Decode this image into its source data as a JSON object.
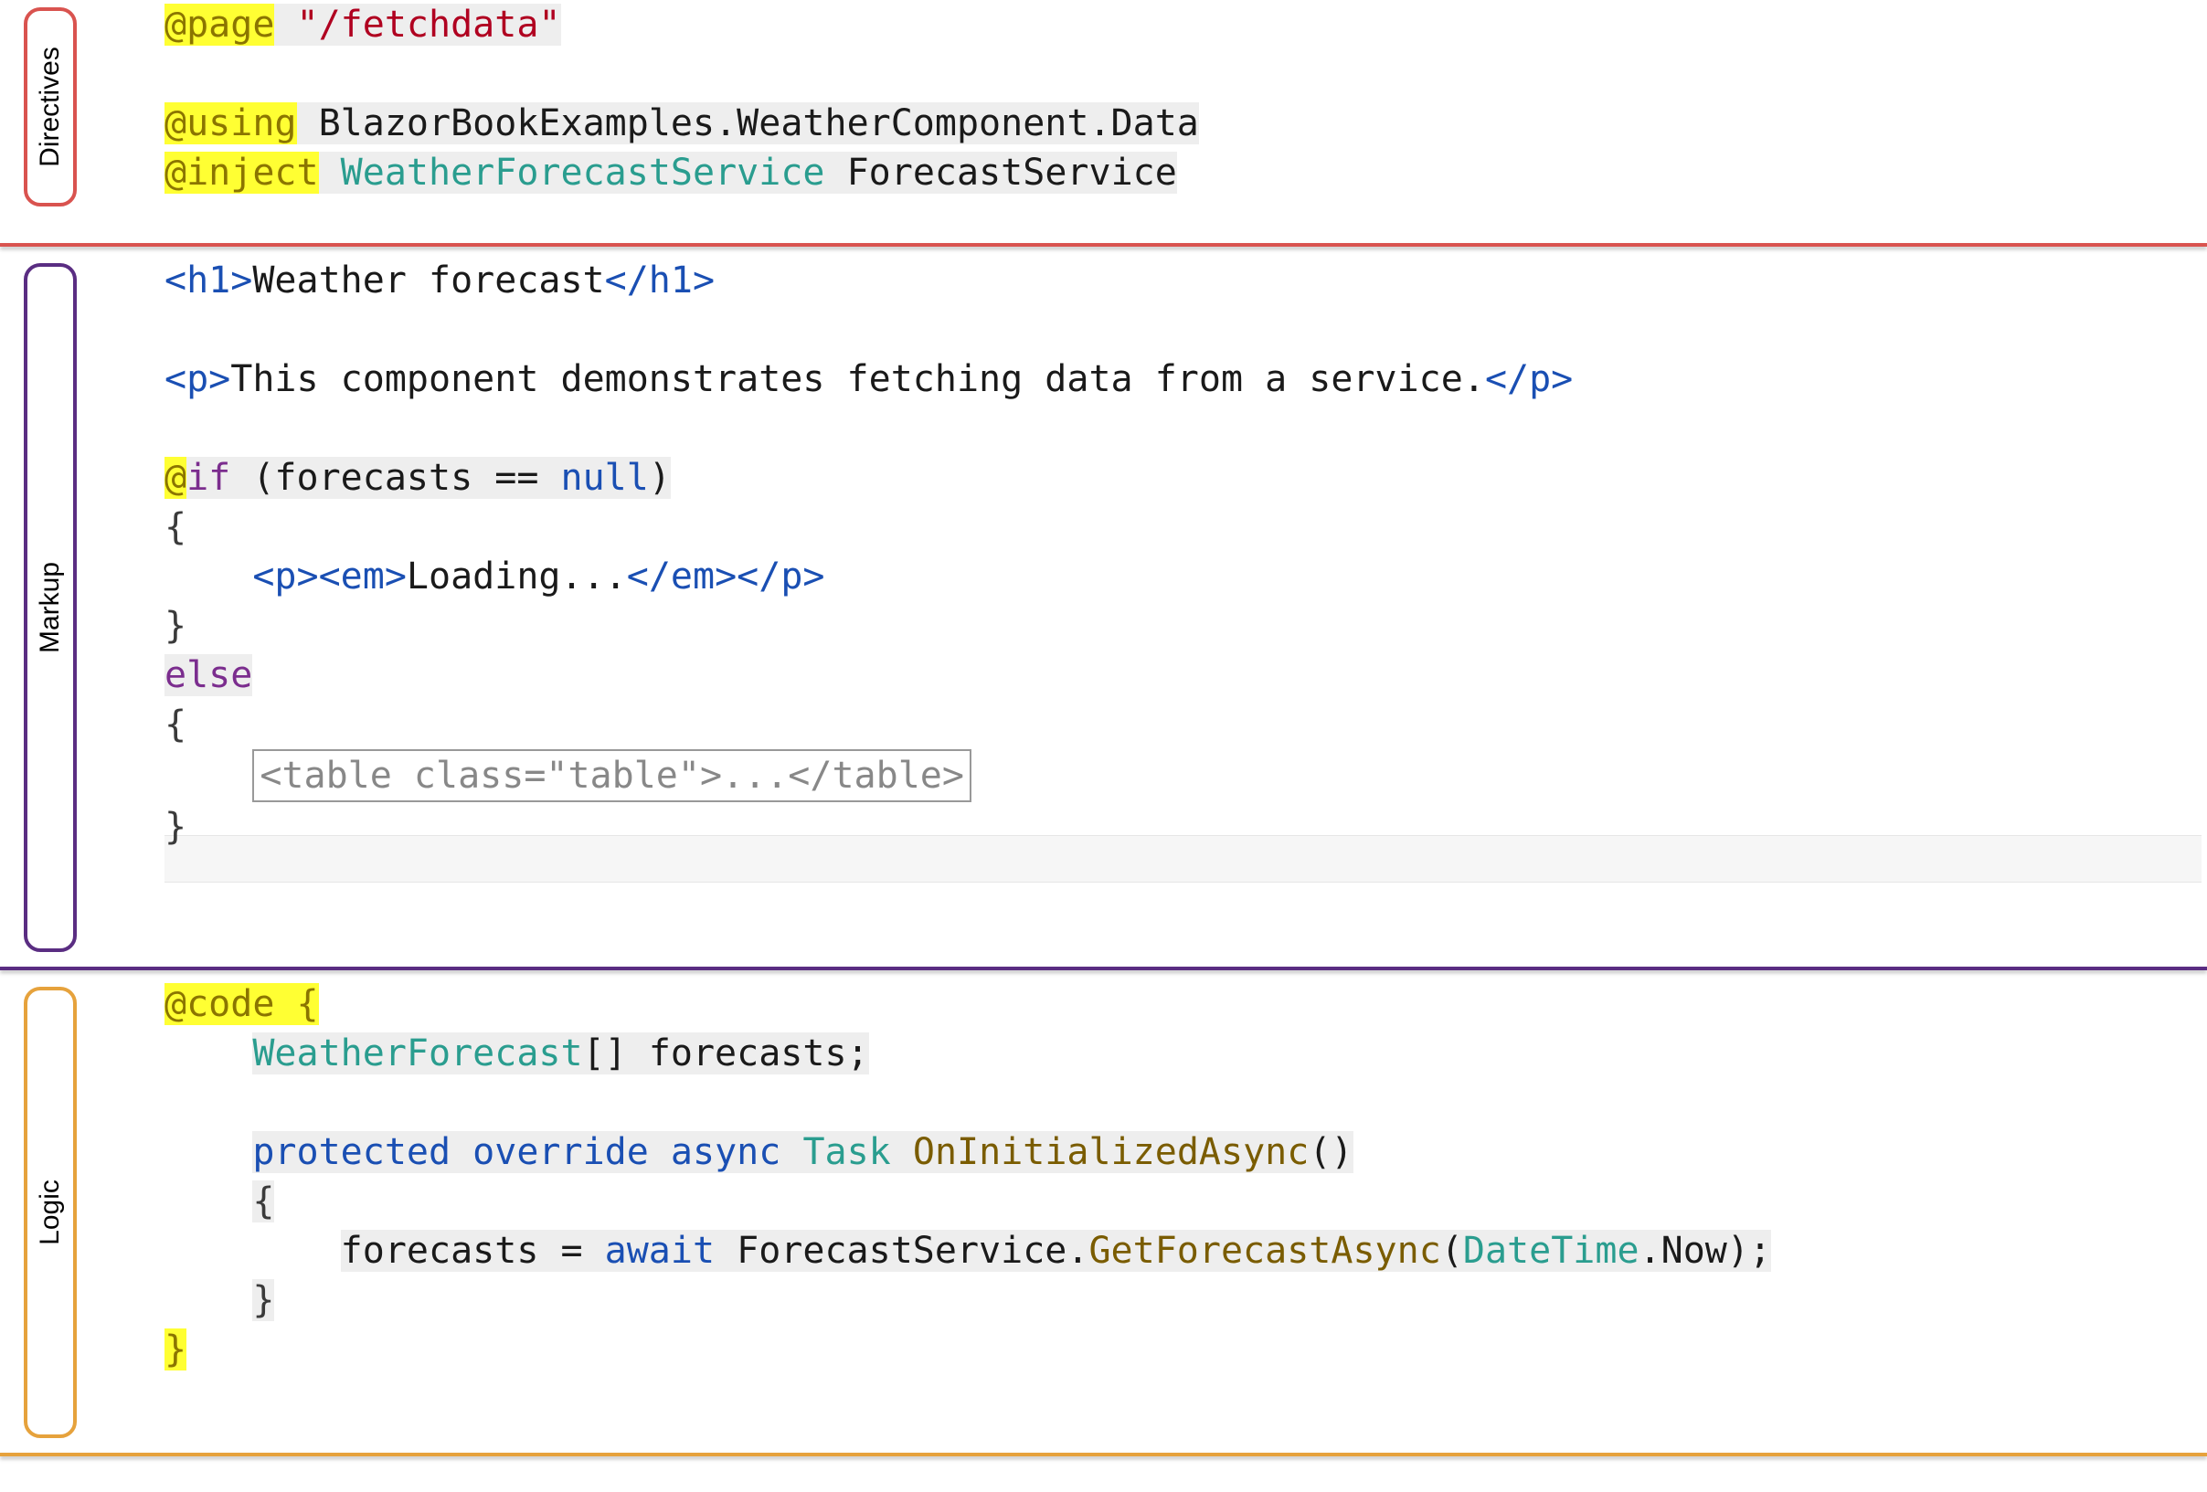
{
  "sections": {
    "directives": {
      "label": "Directives"
    },
    "markup": {
      "label": "Markup"
    },
    "logic": {
      "label": "Logic"
    }
  },
  "directives": {
    "page_kw": "@page",
    "page_val": "\"/fetchdata\"",
    "using_kw": "@using",
    "using_ns": "BlazorBookExamples.WeatherComponent.Data",
    "inject_kw": "@inject",
    "inject_type": "WeatherForecastService",
    "inject_name": "ForecastService"
  },
  "markup": {
    "h1_open": "<h1>",
    "h1_text": "Weather forecast",
    "h1_close": "</h1>",
    "p_open": "<p>",
    "p_text": "This component demonstrates fetching data from a service.",
    "p_close": "</p>",
    "if_at": "@",
    "if_kw": "if",
    "if_cond_open": " (forecasts ",
    "if_eq": "==",
    "if_null": " null",
    "if_cond_close": ")",
    "brace_open": "{",
    "brace_close": "}",
    "loading_p_open": "<p>",
    "loading_em_open": "<em>",
    "loading_text": "Loading...",
    "loading_em_close": "</em>",
    "loading_p_close": "</p>",
    "else_kw": "else",
    "folded": "<table class=\"table\">...</table>"
  },
  "logic": {
    "code_kw": "@code",
    "brace_open": " {",
    "type": "WeatherForecast",
    "arr": "[] ",
    "field": "forecasts;",
    "protected": "protected",
    "override": "override",
    "async": "async",
    "task": "Task",
    "method": "OnInitializedAsync",
    "parens": "()",
    "m_brace_open": "{",
    "assign_left": "forecasts = ",
    "await": "await",
    "svc": " ForecastService.",
    "call": "GetForecastAsync",
    "args_open": "(",
    "datetime": "DateTime",
    "now": ".Now",
    "args_close": ");",
    "m_brace_close": "}",
    "brace_close": "}"
  }
}
